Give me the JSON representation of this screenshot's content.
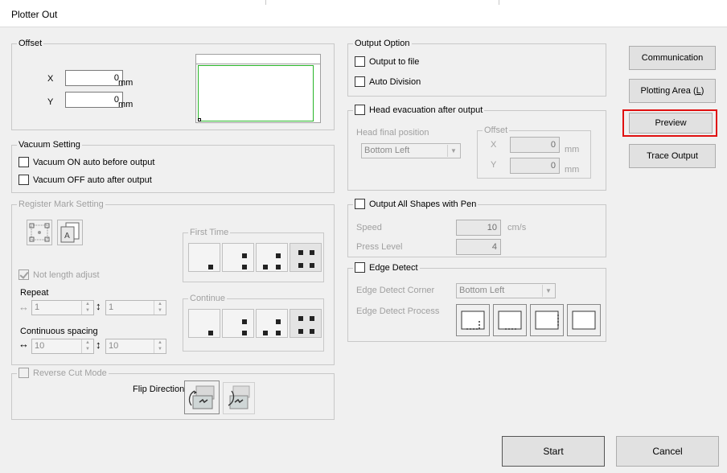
{
  "window": {
    "title": "Plotter Out"
  },
  "offset": {
    "legend": "Offset",
    "x_label": "X",
    "x_value": "0",
    "x_unit": "mm",
    "y_label": "Y",
    "y_value": "0",
    "y_unit": "mm"
  },
  "vacuum": {
    "legend": "Vacuum Setting",
    "on_label": "Vacuum ON auto before output",
    "off_label": "Vacuum OFF auto after output"
  },
  "register": {
    "legend": "Register Mark Setting",
    "not_length_adjust": "Not length adjust",
    "repeat_label": "Repeat",
    "repeat_value1": "1",
    "repeat_value2": "1",
    "continuous_label": "Continuous spacing",
    "continuous_value1": "10",
    "continuous_value2": "10",
    "first_time_legend": "First Time",
    "continue_legend": "Continue"
  },
  "reverse": {
    "legend": "Reverse Cut Mode",
    "flip_label": "Flip Direction"
  },
  "output_option": {
    "legend": "Output Option",
    "to_file": "Output to file",
    "auto_division": "Auto Division"
  },
  "head_evac": {
    "legend": "Head evacuation after output",
    "final_pos_label": "Head final position",
    "final_pos_value": "Bottom Left",
    "offset_legend": "Offset",
    "x_label": "X",
    "x_value": "0",
    "x_unit": "mm",
    "y_label": "Y",
    "y_value": "0",
    "y_unit": "mm"
  },
  "pen": {
    "legend": "Output All Shapes with Pen",
    "speed_label": "Speed",
    "speed_value": "10",
    "speed_unit": "cm/s",
    "press_label": "Press Level",
    "press_value": "4"
  },
  "edge": {
    "legend": "Edge Detect",
    "corner_label": "Edge Detect Corner",
    "corner_value": "Bottom Left",
    "process_label": "Edge Detect Process"
  },
  "buttons": {
    "communication": "Communication",
    "plotting_area_pre": "Plotting Area (",
    "plotting_area_key": "L",
    "plotting_area_post": ")",
    "preview": "Preview",
    "trace_output": "Trace Output",
    "start": "Start",
    "cancel": "Cancel"
  },
  "colors": {
    "preview_highlight": "#e01010",
    "preview_rect": "#27b427",
    "focus_border": "#0078d7"
  }
}
